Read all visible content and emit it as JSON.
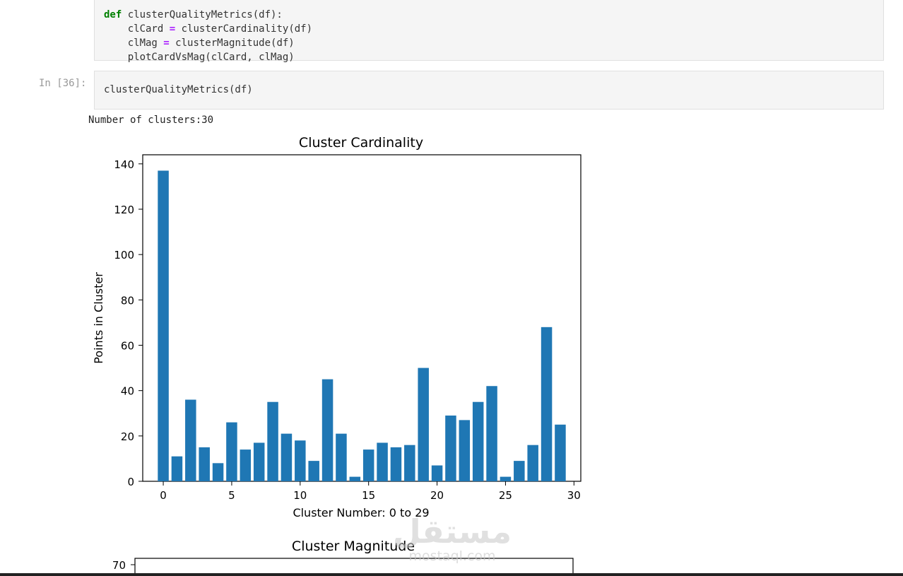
{
  "cell_prev": {
    "lines": [
      {
        "kw": "def ",
        "rest": "clusterQualityMetrics(df):"
      },
      {
        "indent": "    ",
        "lhs": "clCard ",
        "op": "=",
        "rhs": " clusterCardinality(df)"
      },
      {
        "indent": "    ",
        "lhs": "clMag ",
        "op": "=",
        "rhs": " clusterMagnitude(df)"
      },
      {
        "indent": "    ",
        "plain": "plotCardVsMag(clCard, clMag)"
      }
    ]
  },
  "cell_run": {
    "prompt": "In [36]:",
    "code": "clusterQualityMetrics(df)"
  },
  "output": {
    "text": "Number of clusters:30"
  },
  "chart_data": [
    {
      "type": "bar",
      "title": "Cluster Cardinality",
      "xlabel": "Cluster Number: 0 to 29",
      "ylabel": "Points in Cluster",
      "x": [
        0,
        1,
        2,
        3,
        4,
        5,
        6,
        7,
        8,
        9,
        10,
        11,
        12,
        13,
        14,
        15,
        16,
        17,
        18,
        19,
        20,
        21,
        22,
        23,
        24,
        25,
        26,
        27,
        28,
        29
      ],
      "values": [
        137,
        11,
        36,
        15,
        8,
        26,
        14,
        17,
        35,
        21,
        18,
        9,
        45,
        21,
        2,
        14,
        17,
        15,
        16,
        50,
        7,
        29,
        27,
        35,
        42,
        2,
        9,
        16,
        68,
        25
      ],
      "xticks": [
        0,
        5,
        10,
        15,
        20,
        25,
        30
      ],
      "yticks": [
        0,
        20,
        40,
        60,
        80,
        100,
        120,
        140
      ],
      "xlim": [
        -1.5,
        30.5
      ],
      "ylim": [
        0,
        144
      ],
      "bar_color": "#1f77b4"
    },
    {
      "type": "bar",
      "title": "Cluster Magnitude",
      "yticks_visible": [
        70
      ],
      "bar_color": "#1f77b4"
    }
  ],
  "watermark": {
    "arabic": "مستقل",
    "latin": "mostaql.com"
  }
}
